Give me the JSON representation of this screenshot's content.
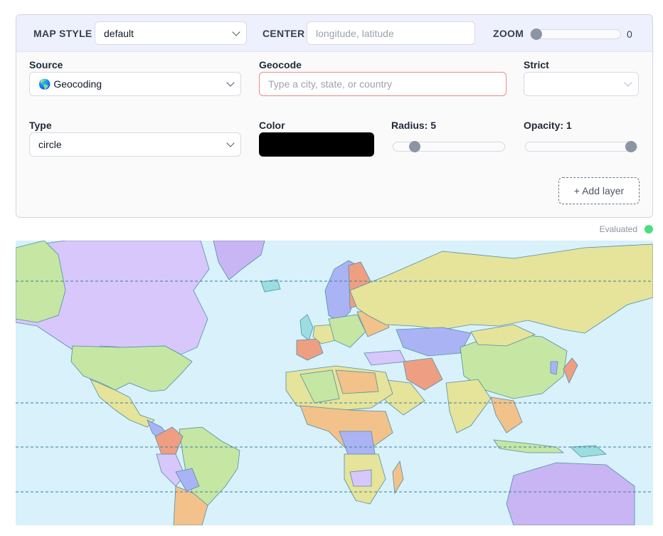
{
  "toolbar": {
    "map_style_label": "MAP STYLE",
    "map_style_value": "default",
    "center_label": "CENTER",
    "center_placeholder": "longitude, latitude",
    "zoom_label": "ZOOM",
    "zoom_value": "0",
    "zoom_level": 0
  },
  "form": {
    "source_label": "Source",
    "source_icon": "globe-icon",
    "source_value": "🌎 Geocoding",
    "geocode_label": "Geocode",
    "geocode_placeholder": "Type a city, state, or country",
    "strict_label": "Strict",
    "strict_value": "",
    "type_label": "Type",
    "type_value": "circle",
    "color_label": "Color",
    "color_value": "#000000",
    "radius_label": "Radius: 5",
    "radius_fraction": 0.16,
    "opacity_label": "Opacity: 1",
    "opacity_fraction": 1.0,
    "add_layer_label": "+ Add layer"
  },
  "status": {
    "text": "Evaluated",
    "color": "#4ade80"
  },
  "map": {
    "ocean_color": "#d8f1fb",
    "graticule_color": "#3d7e99",
    "palette": [
      "#d8c7fb",
      "#c6e6a4",
      "#e6e39a",
      "#f2c28a",
      "#aab4f5",
      "#9cdde0",
      "#ee9f82",
      "#a3d6ff",
      "#c9b5f4"
    ]
  }
}
